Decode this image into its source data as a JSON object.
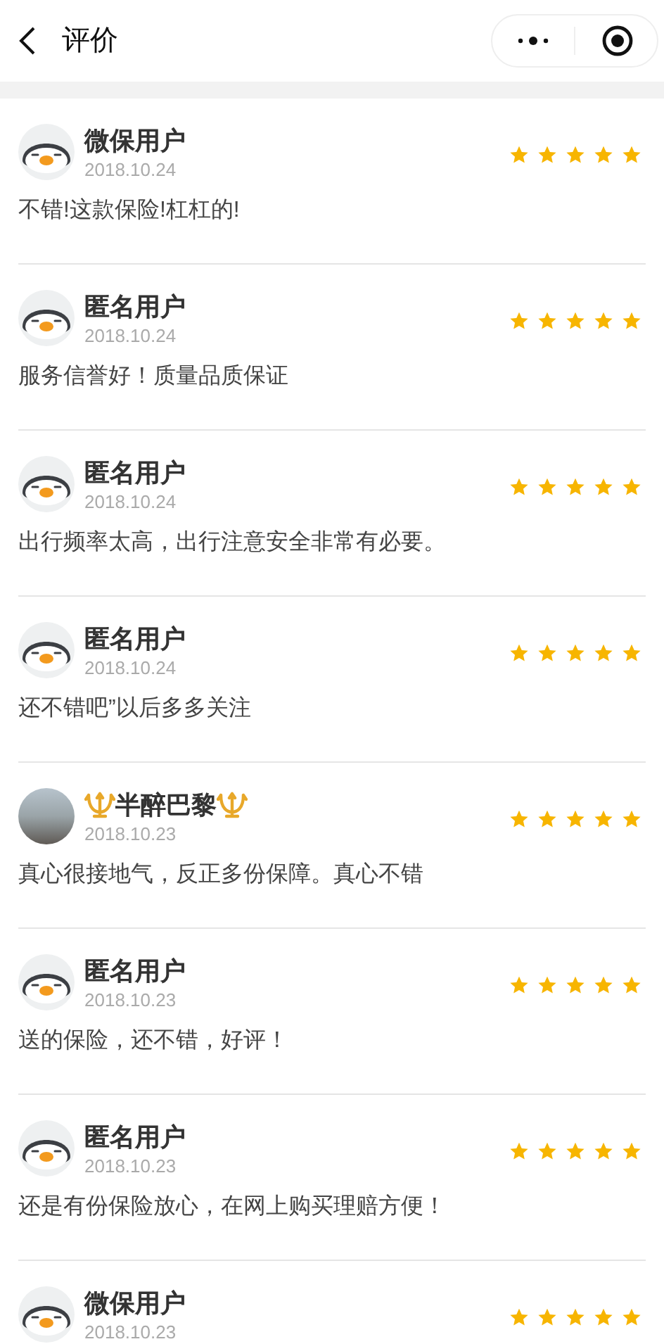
{
  "header": {
    "title": "评价"
  },
  "reviews": [
    {
      "kind": "penguin",
      "name": "微保用户",
      "decorated": false,
      "date": "2018.10.24",
      "stars": 5,
      "comment": "不错!这款保险!杠杠的!"
    },
    {
      "kind": "penguin",
      "name": "匿名用户",
      "decorated": false,
      "date": "2018.10.24",
      "stars": 5,
      "comment": "服务信誉好！质量品质保证"
    },
    {
      "kind": "penguin",
      "name": "匿名用户",
      "decorated": false,
      "date": "2018.10.24",
      "stars": 5,
      "comment": "出行频率太高，出行注意安全非常有必要。"
    },
    {
      "kind": "penguin",
      "name": "匿名用户",
      "decorated": false,
      "date": "2018.10.24",
      "stars": 5,
      "comment": "还不错吧”以后多多关注"
    },
    {
      "kind": "photo",
      "name": "半醉巴黎",
      "decorated": true,
      "date": "2018.10.23",
      "stars": 5,
      "comment": "真心很接地气，反正多份保障。真心不错"
    },
    {
      "kind": "penguin",
      "name": "匿名用户",
      "decorated": false,
      "date": "2018.10.23",
      "stars": 5,
      "comment": "送的保险，还不错，好评！"
    },
    {
      "kind": "penguin",
      "name": "匿名用户",
      "decorated": false,
      "date": "2018.10.23",
      "stars": 5,
      "comment": "还是有份保险放心，在网上购买理赔方便！"
    },
    {
      "kind": "penguin",
      "name": "微保用户",
      "decorated": false,
      "date": "2018.10.23",
      "stars": 5
    }
  ]
}
